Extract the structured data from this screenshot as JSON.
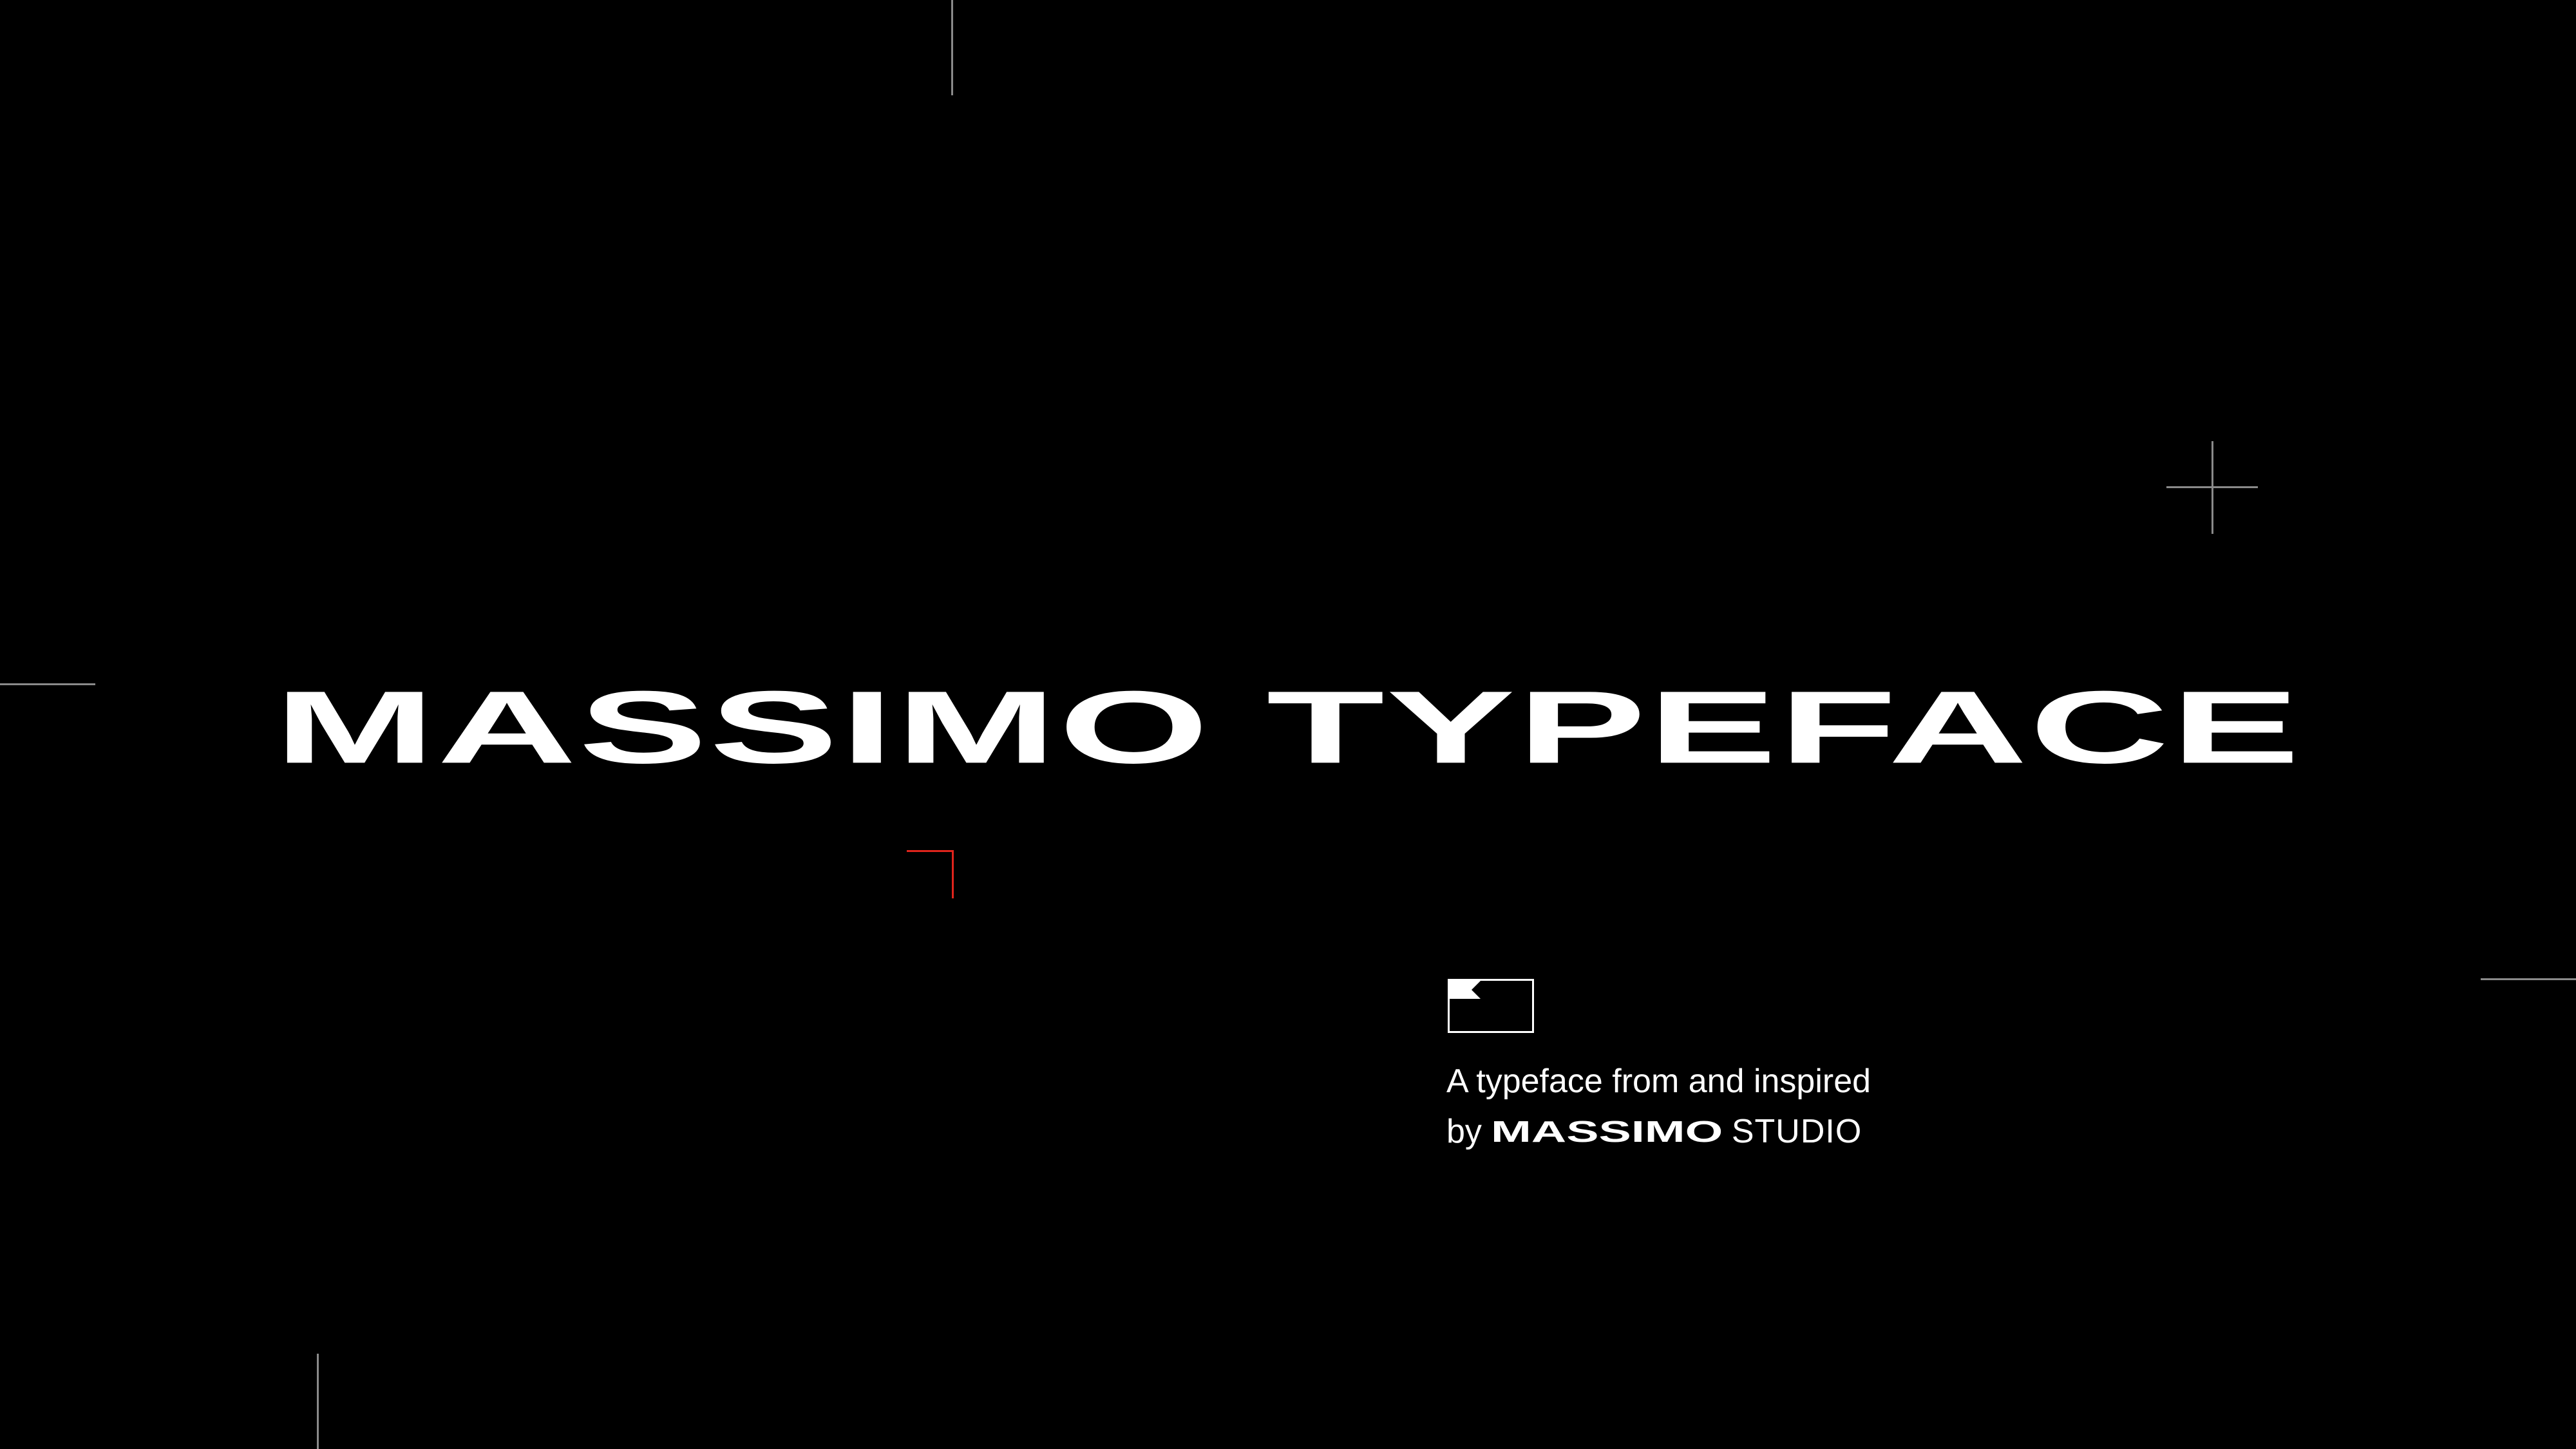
{
  "headline": "MASSIMO TYPEFACE",
  "tagline": {
    "line1": "A typeface from and inspired",
    "by": "by",
    "brand": "MASSIMO",
    "studio": "STUDIO"
  },
  "colors": {
    "background": "#000000",
    "text": "#ffffff",
    "guide_lines": "#8a8a8a",
    "accent": "#e0241c"
  },
  "icons": {
    "logo": "studio-logo-icon"
  }
}
